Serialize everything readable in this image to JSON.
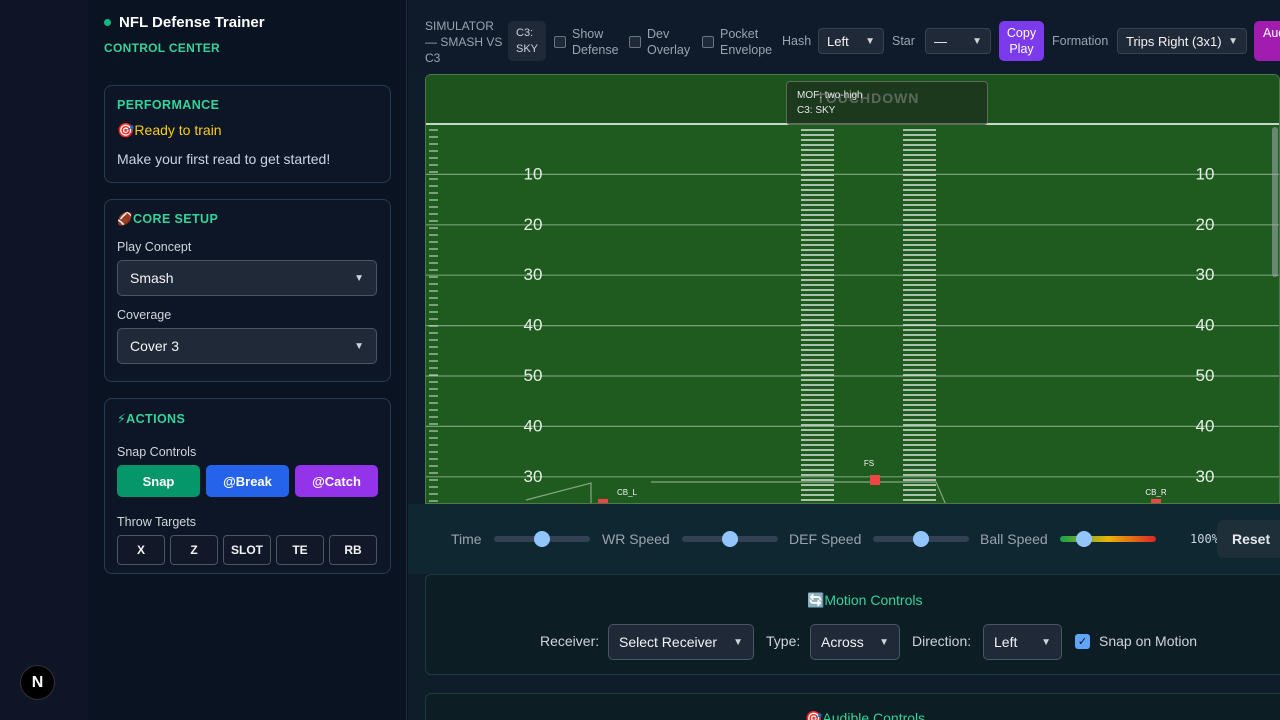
{
  "app": {
    "title": "NFL Defense Trainer",
    "subtitle": "CONTROL CENTER",
    "badge": "N"
  },
  "performance": {
    "title": "PERFORMANCE",
    "status": "🎯Ready to train",
    "message": "Make your first read to get started!"
  },
  "core_setup": {
    "title": "🏈CORE SETUP",
    "play_concept_label": "Play Concept",
    "play_concept_value": "Smash",
    "coverage_label": "Coverage",
    "coverage_value": "Cover 3"
  },
  "actions": {
    "title": "⚡ACTIONS",
    "snap_controls_label": "Snap Controls",
    "snap": "Snap",
    "break": "@Break",
    "catch": "@Catch",
    "throw_targets_label": "Throw Targets",
    "targets": [
      "X",
      "Z",
      "SLOT",
      "TE",
      "RB"
    ]
  },
  "toolbar": {
    "sim_title": "SIMULATOR — SMASH VS C3",
    "c3_badge": "C3: SKY",
    "show_defense": "Show Defense",
    "dev_overlay": "Dev Overlay",
    "pocket_envelope": "Pocket Envelope",
    "hash_label": "Hash",
    "hash_value": "Left",
    "star_label": "Star",
    "star_value": "—",
    "copy_play": "Copy Play",
    "formation_label": "Formation",
    "formation_value": "Trips Right (3x1)",
    "audible_btn": "Audible"
  },
  "field": {
    "endzone_text": "TOUCHDOWN",
    "tooltip_line1": "MOF: two-high",
    "tooltip_line2": "C3: SKY",
    "yard_numbers": [
      "10",
      "20",
      "30",
      "40",
      "50",
      "40",
      "30"
    ],
    "players": [
      {
        "label": "FS",
        "color": "#ef4444"
      },
      {
        "label": "CB_L",
        "color": "#ef4444"
      },
      {
        "label": "CB_R",
        "color": "#ef4444"
      }
    ],
    "colors": {
      "turf": "#1f5a1f",
      "turf_alt": "#236123",
      "lines": "#9fbf9f"
    }
  },
  "speed": {
    "time_label": "Time",
    "time_level": 0.5,
    "wr_label": "WR Speed",
    "wr_level": 0.5,
    "def_label": "DEF Speed",
    "def_level": 0.5,
    "ball_label": "Ball Speed",
    "ball_level": 0.25,
    "ball_pct": "100%",
    "reset": "Reset"
  },
  "motion": {
    "title": "🔄Motion Controls",
    "receiver_label": "Receiver:",
    "receiver_value": "Select Receiver",
    "type_label": "Type:",
    "type_value": "Across",
    "direction_label": "Direction:",
    "direction_value": "Left",
    "snap_on_motion": "Snap on Motion"
  },
  "audible": {
    "title": "🎯Audible Controls"
  }
}
